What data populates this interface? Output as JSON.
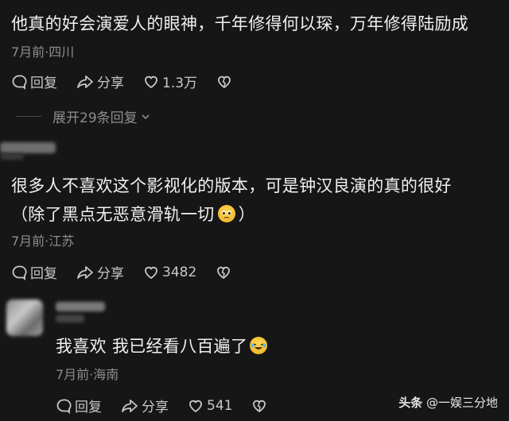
{
  "comment1": {
    "text": "他真的好会演爱人的眼神，千年修得何以琛，万年修得陆励成",
    "meta": "7月前·四川",
    "reply_label": "回复",
    "share_label": "分享",
    "likes": "1.3万"
  },
  "expand_label": "展开29条回复",
  "comment2": {
    "text_line1": "很多人不喜欢这个影视化的版本，可是钟汉良演的真的很好",
    "text_line2_pre": "（除了黑点无恶意滑轨一切",
    "text_line2_post": "）",
    "meta": "7月前·江苏",
    "reply_label": "回复",
    "share_label": "分享",
    "likes": "3482"
  },
  "comment3": {
    "text": "我喜欢 我已经看八百遍了",
    "meta": "7月前·海南",
    "reply_label": "回复",
    "share_label": "分享",
    "likes": "541"
  },
  "watermark": {
    "brand": "头条",
    "author": "@一娱三分地"
  },
  "colors": {
    "background": "#161616",
    "text": "#f1f1f1",
    "meta": "#8d8d8d",
    "action": "#c8c8c8"
  }
}
